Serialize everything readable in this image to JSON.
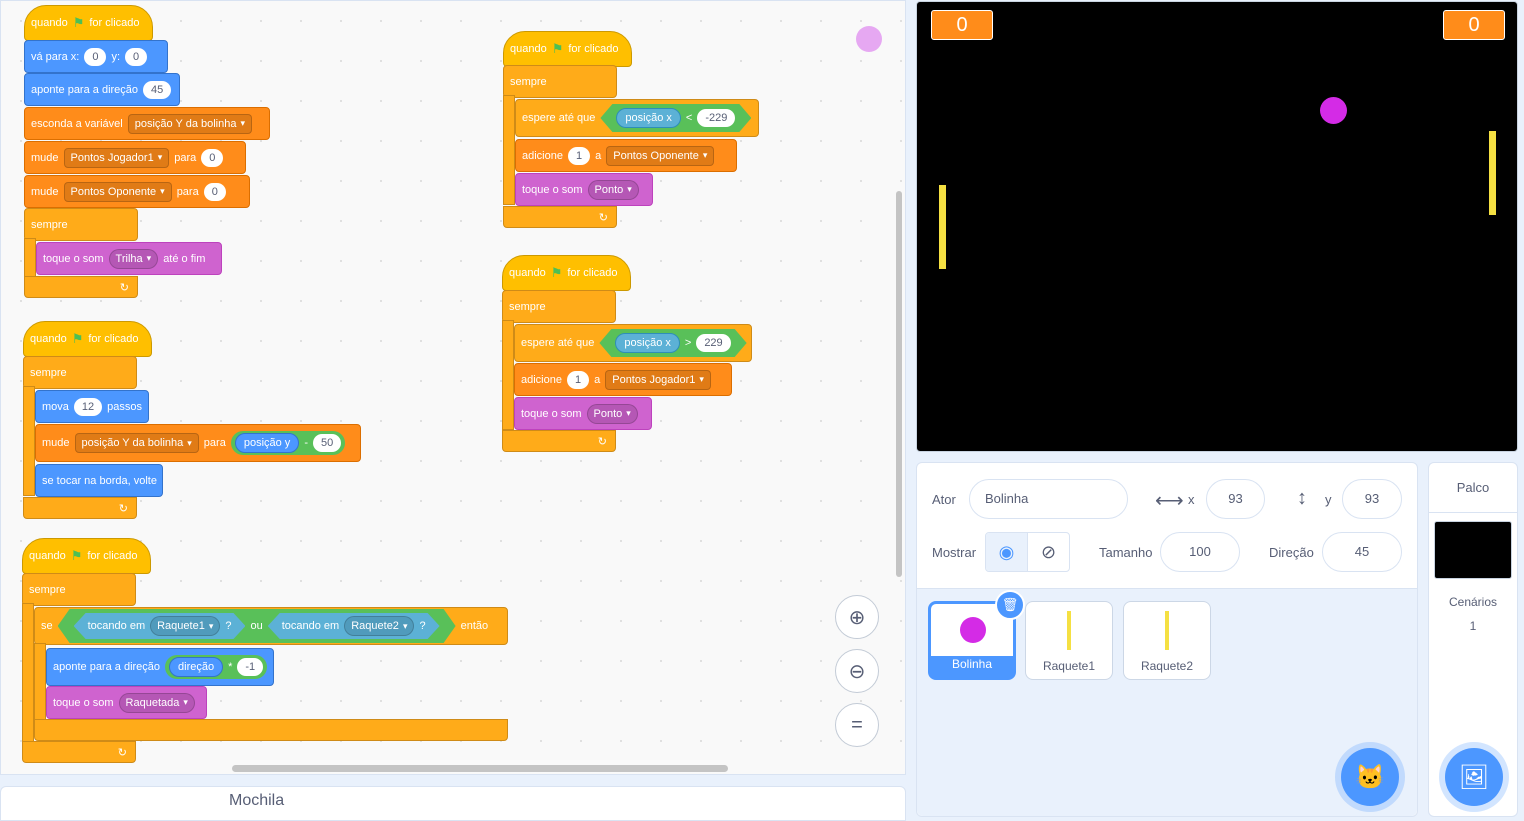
{
  "colors": {
    "events": "#ffbf00",
    "control": "#ffab19",
    "motion": "#4c97ff",
    "variables": "#ff8c1a",
    "sound": "#cf63cf",
    "sensing": "#5cb1d6",
    "operators": "#59c059"
  },
  "s1": {
    "hat_when": "quando",
    "hat_clicked": "for clicado",
    "goto_a": "vá para x:",
    "goto_x": "0",
    "goto_b": "y:",
    "goto_y": "0",
    "point_label": "aponte para a direção",
    "point_val": "45",
    "hide_label": "esconda a variável",
    "hide_var": "posição Y da bolinha",
    "set1_label": "mude",
    "set1_var": "Pontos Jogador1",
    "set1_to": "para",
    "set1_val": "0",
    "set2_label": "mude",
    "set2_var": "Pontos Oponente",
    "set2_to": "para",
    "set2_val": "0",
    "forever": "sempre",
    "play_label": "toque o som",
    "play_sound": "Trilha",
    "play_end": "até o fim"
  },
  "s2": {
    "hat_when": "quando",
    "hat_clicked": "for clicado",
    "forever": "sempre",
    "move_label": "mova",
    "move_val": "12",
    "move_unit": "passos",
    "set_label": "mude",
    "set_var": "posição Y da bolinha",
    "set_to": "para",
    "rep_y": "posição y",
    "op_minus": "-",
    "op_val": "50",
    "bounce": "se tocar na borda, volte"
  },
  "s3": {
    "hat_when": "quando",
    "hat_clicked": "for clicado",
    "forever": "sempre",
    "if": "se",
    "touch1": "tocando em",
    "touch1_obj": "Raquete1",
    "q1": "?",
    "or": "ou",
    "touch2": "tocando em",
    "touch2_obj": "Raquete2",
    "q2": "?",
    "then": "então",
    "point_label": "aponte para a direção",
    "rep_dir": "direção",
    "op_times": "*",
    "op_val": "-1",
    "play_label": "toque o som",
    "play_sound": "Raquetada"
  },
  "s4": {
    "hat_when": "quando",
    "hat_clicked": "for clicado",
    "forever": "sempre",
    "wait_label": "espere até que",
    "rep_x": "posição x",
    "op_lt": "<",
    "op_val": "-229",
    "change_label": "adicione",
    "change_val": "1",
    "change_a": "a",
    "change_var": "Pontos Oponente",
    "play_label": "toque o som",
    "play_sound": "Ponto"
  },
  "s5": {
    "hat_when": "quando",
    "hat_clicked": "for clicado",
    "forever": "sempre",
    "wait_label": "espere até que",
    "rep_x": "posição x",
    "op_gt": ">",
    "op_val": "229",
    "change_label": "adicione",
    "change_val": "1",
    "change_a": "a",
    "change_var": "Pontos Jogador1",
    "play_label": "toque o som",
    "play_sound": "Ponto"
  },
  "backpack": "Mochila",
  "stage": {
    "score_left": "0",
    "score_right": "0"
  },
  "sprite_info": {
    "actor_label": "Ator",
    "actor_name": "Bolinha",
    "x_label": "x",
    "x_val": "93",
    "y_label": "y",
    "y_val": "93",
    "show_label": "Mostrar",
    "size_label": "Tamanho",
    "size_val": "100",
    "dir_label": "Direção",
    "dir_val": "45"
  },
  "sprites": [
    {
      "name": "Bolinha"
    },
    {
      "name": "Raquete1"
    },
    {
      "name": "Raquete2"
    }
  ],
  "stage_panel": {
    "title": "Palco",
    "backdrops_label": "Cenários",
    "backdrops_count": "1"
  }
}
